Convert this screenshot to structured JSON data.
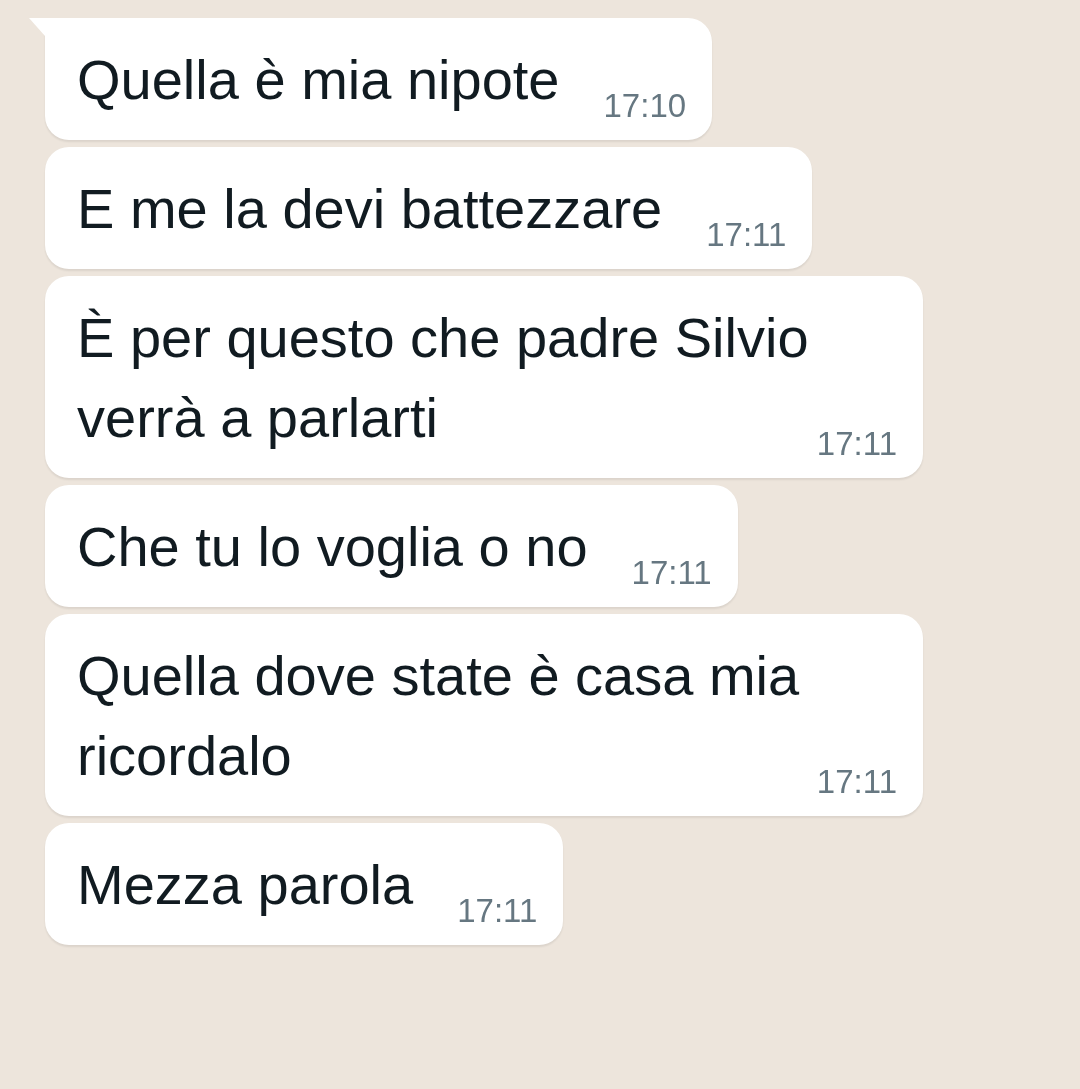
{
  "messages": [
    {
      "text": "Quella è mia nipote",
      "time": "17:10",
      "tail": true
    },
    {
      "text": "E me la devi battezzare",
      "time": "17:11",
      "tail": false
    },
    {
      "text": "È per questo che padre Silvio verrà a parlarti",
      "time": "17:11",
      "tail": false
    },
    {
      "text": "Che tu lo voglia o no",
      "time": "17:11",
      "tail": false
    },
    {
      "text": "Quella dove state è casa mia ricordalo",
      "time": "17:11",
      "tail": false
    },
    {
      "text": "Mezza parola",
      "time": "17:11",
      "tail": false
    }
  ]
}
